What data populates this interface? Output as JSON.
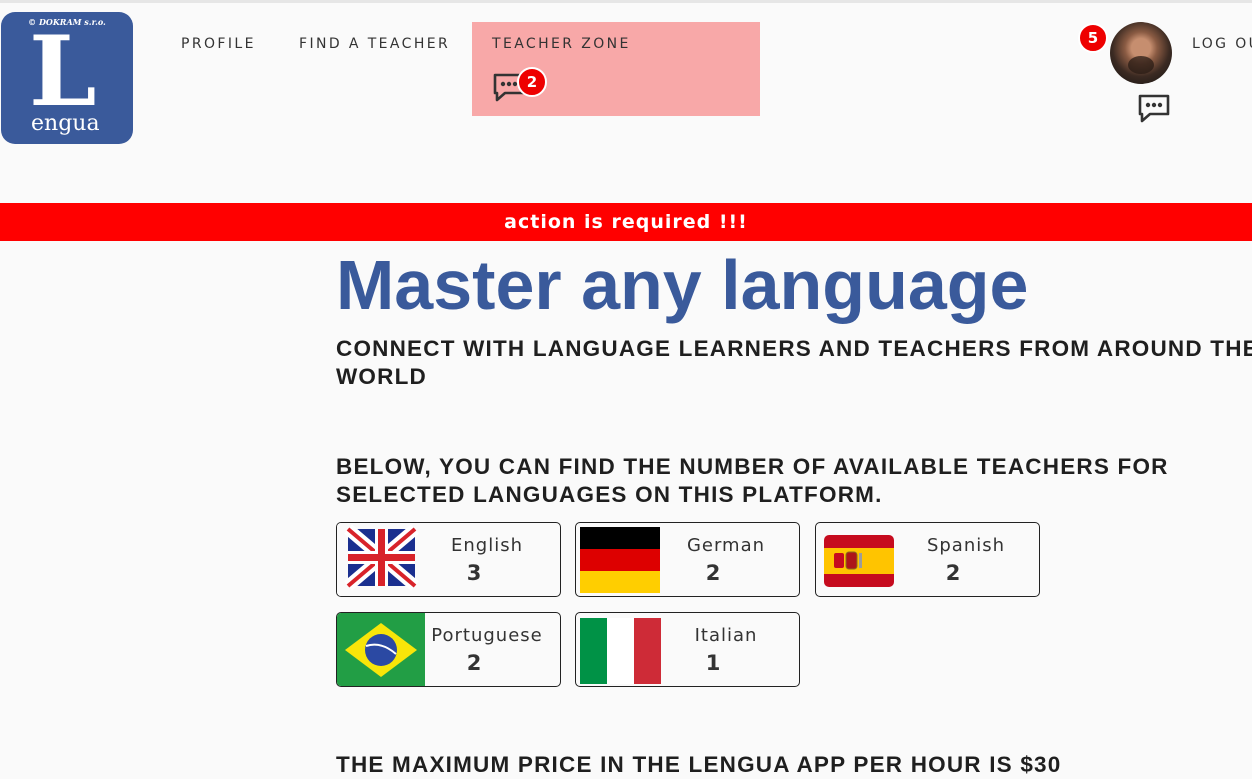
{
  "logo": {
    "copyright": "© DOKRAM s.r.o.",
    "letter": "L",
    "word": "engua"
  },
  "nav": {
    "profile": "PROFILE",
    "find_teacher": "FIND A TEACHER",
    "teacher_zone": "TEACHER ZONE",
    "logout": "LOG OUT",
    "teacher_zone_messages": "2",
    "notifications": "5"
  },
  "alert": "action is required !!!",
  "hero": {
    "title": "Master any language",
    "subtitle": "CONNECT WITH LANGUAGE LEARNERS AND TEACHERS FROM AROUND THE WORLD"
  },
  "teachers": {
    "heading": "BELOW, YOU CAN FIND THE NUMBER OF AVAILABLE TEACHERS FOR SELECTED LANGUAGES ON THIS PLATFORM.",
    "languages": [
      {
        "name": "English",
        "count": "3",
        "flag": "uk-flag-icon"
      },
      {
        "name": "German",
        "count": "2",
        "flag": "germany-flag-icon"
      },
      {
        "name": "Spanish",
        "count": "2",
        "flag": "spain-flag-icon"
      },
      {
        "name": "Portuguese",
        "count": "2",
        "flag": "brazil-flag-icon"
      },
      {
        "name": "Italian",
        "count": "1",
        "flag": "italy-flag-icon"
      }
    ]
  },
  "price": {
    "text": "THE MAXIMUM PRICE IN THE LENGUA APP PER HOUR IS $30"
  },
  "colors": {
    "brand": "#3a5a9b",
    "alert": "#ff0000",
    "teacher_zone_bg": "#f8a8a8",
    "badge": "#ee0000"
  },
  "icons": {
    "chat": "chat-bubble-icon"
  }
}
